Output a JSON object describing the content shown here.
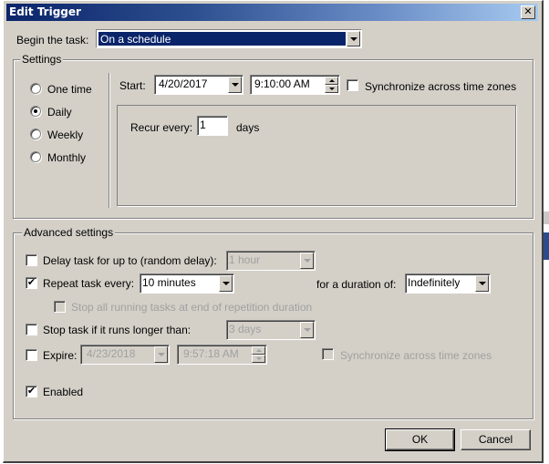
{
  "dialog": {
    "title": "Edit Trigger",
    "close_icon": "close-icon"
  },
  "begin": {
    "label": "Begin the task:",
    "value": "On a schedule"
  },
  "settings": {
    "group_title": "Settings",
    "schedule_options": [
      {
        "label": "One time",
        "selected": false
      },
      {
        "label": "Daily",
        "selected": true
      },
      {
        "label": "Weekly",
        "selected": false
      },
      {
        "label": "Monthly",
        "selected": false
      }
    ],
    "start_label": "Start:",
    "start_date": "4/20/2017",
    "start_time": "9:10:00 AM",
    "sync_label": "Synchronize across time zones",
    "sync_checked": false,
    "recur_label": "Recur every:",
    "recur_value": "1",
    "recur_unit": "days"
  },
  "advanced": {
    "group_title": "Advanced settings",
    "delay": {
      "label": "Delay task for up to (random delay):",
      "checked": false,
      "value": "1 hour"
    },
    "repeat": {
      "label": "Repeat task every:",
      "checked": true,
      "value": "10 minutes",
      "duration_label": "for a duration of:",
      "duration_value": "Indefinitely"
    },
    "stop_all": {
      "label": "Stop all running tasks at end of repetition duration",
      "checked": false
    },
    "stop_longer": {
      "label": "Stop task if it runs longer than:",
      "checked": false,
      "value": "3 days"
    },
    "expire": {
      "label": "Expire:",
      "checked": false,
      "date": "4/23/2018",
      "time": "9:57:18 AM",
      "sync_label": "Synchronize across time zones",
      "sync_checked": false
    },
    "enabled": {
      "label": "Enabled",
      "checked": true
    }
  },
  "buttons": {
    "ok": "OK",
    "cancel": "Cancel"
  },
  "glyphs": {
    "check": "✔",
    "close": "✕"
  }
}
